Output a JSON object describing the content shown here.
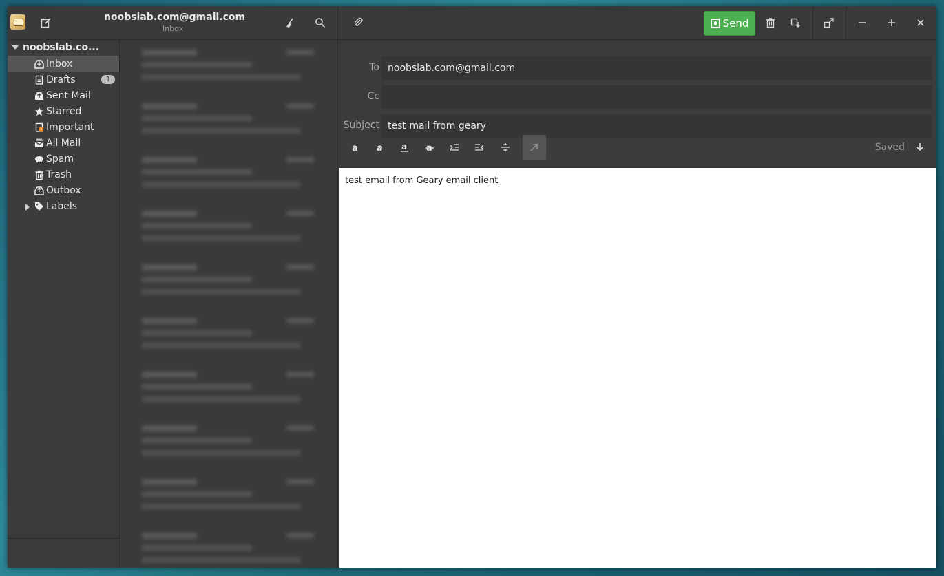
{
  "header": {
    "account_title": "noobslab.com@gmail.com",
    "account_subtitle": "Inbox",
    "send_label": "Send"
  },
  "sidebar": {
    "account": "noobslab.co...",
    "folders": [
      {
        "label": "Inbox",
        "icon": "inbox-icon",
        "active": true
      },
      {
        "label": "Drafts",
        "icon": "drafts-icon",
        "badge": "1"
      },
      {
        "label": "Sent Mail",
        "icon": "sent-icon"
      },
      {
        "label": "Starred",
        "icon": "star-icon"
      },
      {
        "label": "Important",
        "icon": "important-icon"
      },
      {
        "label": "All Mail",
        "icon": "all-mail-icon"
      },
      {
        "label": "Spam",
        "icon": "spam-icon"
      },
      {
        "label": "Trash",
        "icon": "trash-icon"
      },
      {
        "label": "Outbox",
        "icon": "outbox-icon"
      },
      {
        "label": "Labels",
        "icon": "tag-icon"
      }
    ]
  },
  "composer": {
    "to_label": "To",
    "to_value": "noobslab.com@gmail.com",
    "cc_label": "Cc",
    "cc_value": "",
    "subject_label": "Subject",
    "subject_value": "test mail from geary",
    "saved_label": "Saved",
    "body_text": "test email from Geary email client"
  },
  "colors": {
    "send_green": "#4caf50",
    "window_bg": "#3c3c3c"
  }
}
